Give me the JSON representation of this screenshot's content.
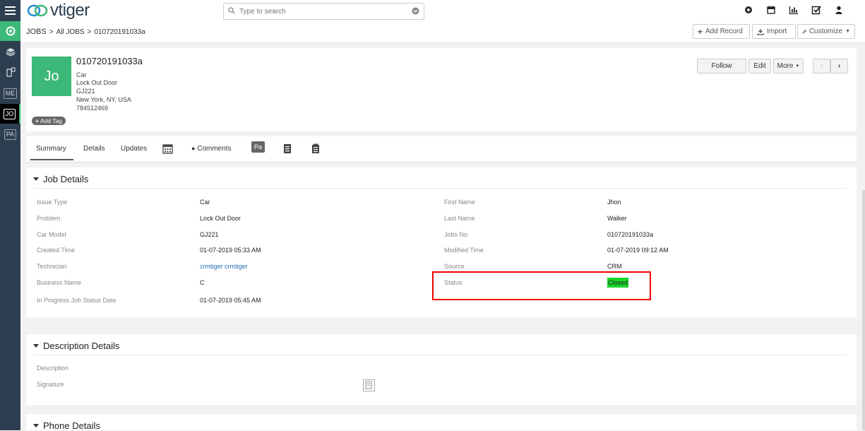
{
  "app": {
    "logo_text": "vtiger"
  },
  "search": {
    "placeholder": "Type to search"
  },
  "breadcrumb": {
    "module": "JOBS",
    "list": "All JOBS",
    "record": "010720191033a"
  },
  "toolbar": {
    "add_record": "Add Record",
    "import": "Import",
    "customize": "Customize"
  },
  "sidebar": {
    "items": [
      "ME",
      "JO",
      "PA"
    ]
  },
  "record": {
    "avatar_initials": "Jo",
    "title": "010720191033a",
    "lines": [
      "Car",
      "Lock Out Door",
      "GJ221",
      "New York, NY, USA",
      "784512469"
    ],
    "add_tag": "Add Tag"
  },
  "actions": {
    "follow": "Follow",
    "edit": "Edit",
    "more": "More"
  },
  "tabs": {
    "summary": "Summary",
    "details": "Details",
    "updates": "Updates",
    "comments": "Comments",
    "pa_badge": "Pa"
  },
  "job_details": {
    "title": "Job Details",
    "left": [
      {
        "label": "Issue Type",
        "value": "Car"
      },
      {
        "label": "Problem",
        "value": "Lock Out Door"
      },
      {
        "label": "Car Model",
        "value": "GJ221"
      },
      {
        "label": "Created Time",
        "value": "01-07-2019 05:33 AM"
      },
      {
        "label": "Technician",
        "value": "crmtiger crmtiger"
      },
      {
        "label": "Business Name",
        "value": "C"
      },
      {
        "label": "In Progress Job Status Date",
        "value": "01-07-2019 05:45 AM"
      }
    ],
    "right": [
      {
        "label": "First Name",
        "value": "Jhon"
      },
      {
        "label": "Last Name",
        "value": "Walker"
      },
      {
        "label": "Jobs No",
        "value": "010720191033a"
      },
      {
        "label": "Modified Time",
        "value": "01-07-2019 09:12 AM"
      },
      {
        "label": "Source",
        "value": "CRM"
      },
      {
        "label": "Status",
        "value": "Closed"
      }
    ]
  },
  "description_details": {
    "title": "Description Details",
    "description_label": "Description",
    "signature_label": "Signature"
  },
  "phone_details": {
    "title": "Phone Details"
  },
  "colors": {
    "sidebar": "#2d3e50",
    "avatar": "#3cb878",
    "status_closed": "#1bd62a",
    "highlight": "#e00000",
    "link": "#1f6fb5"
  }
}
